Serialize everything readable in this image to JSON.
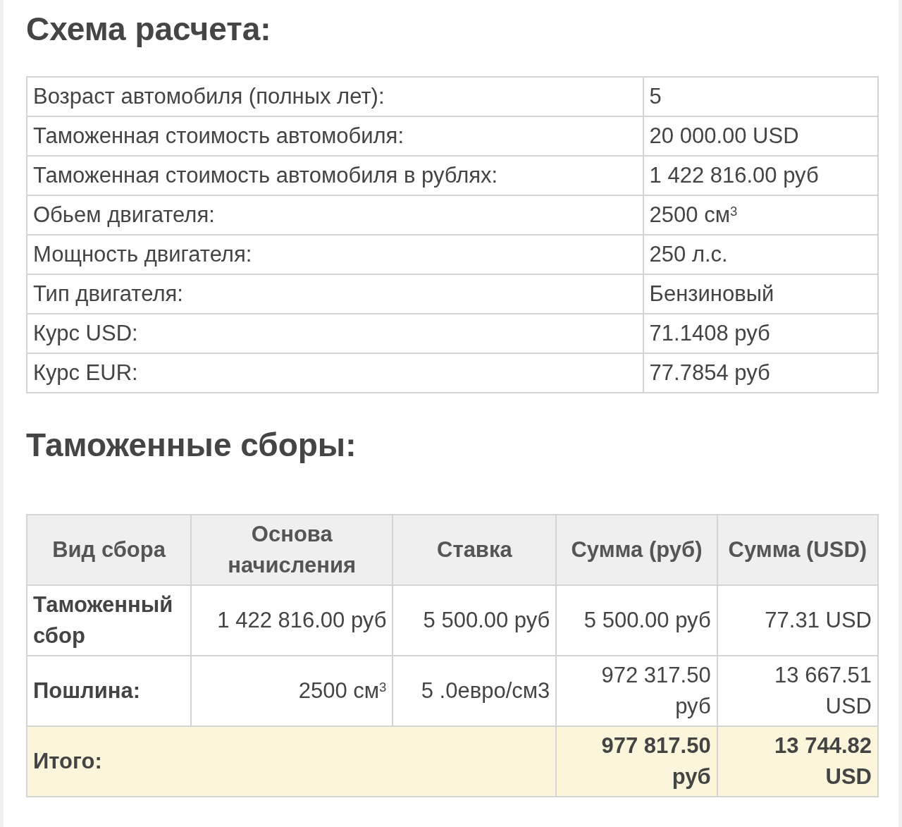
{
  "calc_scheme": {
    "title": "Схема расчета:",
    "rows": [
      {
        "label": "Возраст автомобиля (полных лет):",
        "value": "5"
      },
      {
        "label": "Таможенная стоимость автомобиля:",
        "value": "20 000.00 USD"
      },
      {
        "label": "Таможенная стоимость автомобиля в рублях:",
        "value": "1 422 816.00 руб"
      },
      {
        "label": "Обьем двигателя:",
        "value": "2500 см$^{3}$"
      },
      {
        "label": "Мощность двигателя:",
        "value": "250 л.с."
      },
      {
        "label": "Тип двигателя:",
        "value": "Бензиновый"
      },
      {
        "label": "Курс USD:",
        "value": "71.1408 руб"
      },
      {
        "label": "Курс EUR:",
        "value": "77.7854 руб"
      }
    ]
  },
  "customs_fees": {
    "title": "Таможенные сборы:",
    "columns": [
      "Вид сбора",
      "Основа начисления",
      "Ставка",
      "Сумма (руб)",
      "Сумма (USD)"
    ],
    "rows": [
      {
        "cells": [
          "Таможенный сбор",
          "1 422 816.00 руб",
          "5 500.00 руб",
          "5 500.00 руб",
          "77.31 USD"
        ]
      },
      {
        "cells": [
          "Пошлина:",
          "2500 см$^{3}$",
          "5 .0евро/см3",
          "972 317.50 руб",
          "13 667.51 USD"
        ]
      }
    ],
    "total": {
      "label": "Итого:",
      "sum_rub": "977 817.50 руб",
      "sum_usd": "13 744.82 USD"
    }
  }
}
